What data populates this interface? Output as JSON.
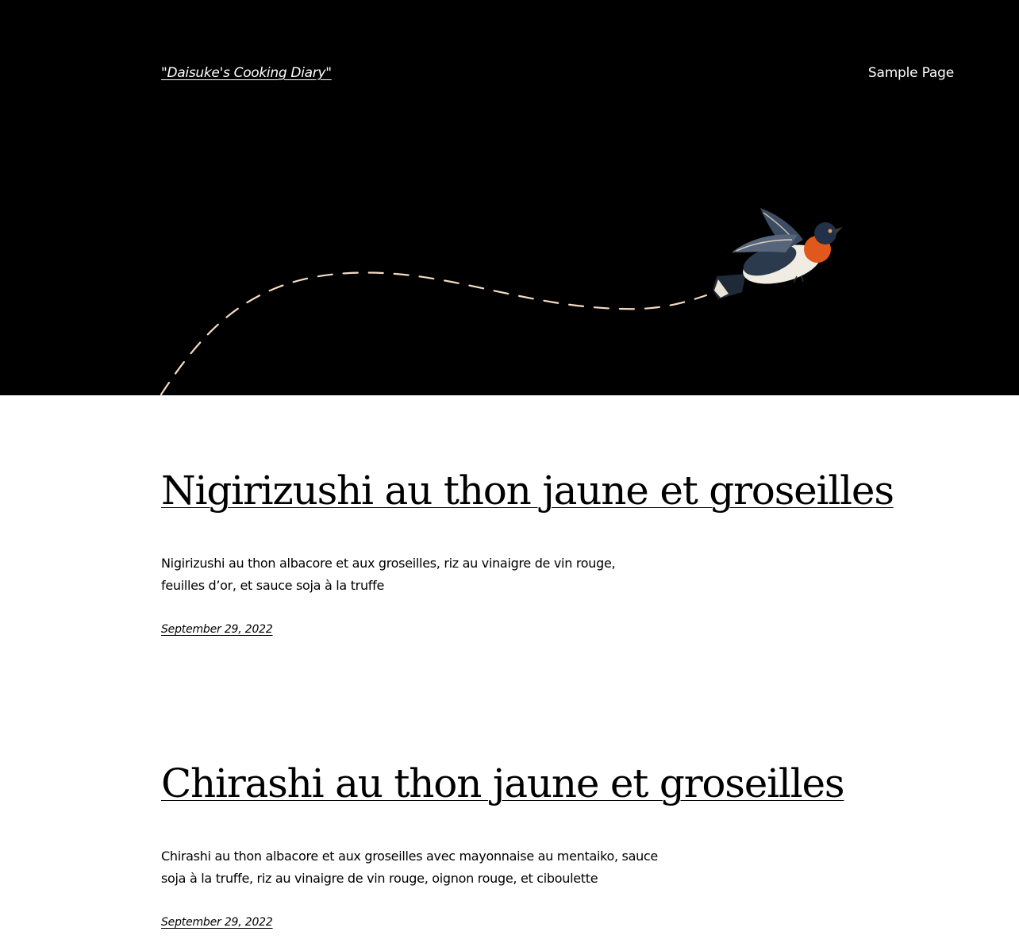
{
  "header": {
    "site_title": "\"Daisuke's Cooking Diary\"",
    "nav": [
      "Sample Page"
    ]
  },
  "hero": {
    "background": "#000000",
    "path_color": "#f3dcc4",
    "illustration": "flying-bird-icon"
  },
  "posts": [
    {
      "title": "Nigirizushi au thon jaune et groseilles",
      "excerpt_lines": [
        "Nigirizushi au thon albacore et aux groseilles, riz au vinaigre de vin rouge,",
        "feuilles d’or, et sauce soja à la truffe"
      ],
      "date": "September 29, 2022"
    },
    {
      "title": "Chirashi au thon jaune et groseilles",
      "excerpt_lines": [
        "Chirashi au thon albacore et aux groseilles avec mayonnaise au mentaiko, sauce",
        "soja à la truffe, riz au vinaigre de vin rouge, oignon rouge, et ciboulette"
      ],
      "date": "September 29, 2022"
    }
  ]
}
